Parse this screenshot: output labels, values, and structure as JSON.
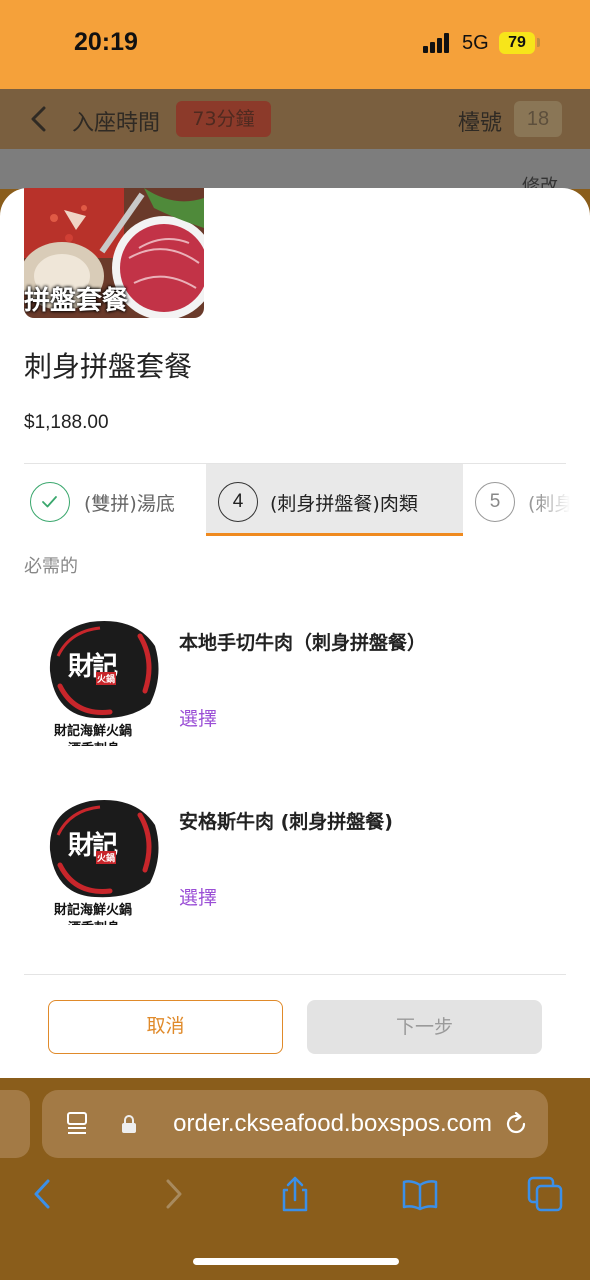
{
  "status": {
    "time": "20:19",
    "network": "5G",
    "battery": "79"
  },
  "header": {
    "seat_time_label": "入座時間",
    "seat_time_value": "73分鐘",
    "table_label": "檯號",
    "table_number": "18",
    "edit": "修改"
  },
  "product": {
    "image_caption": "拼盤套餐",
    "name": "刺身拼盤套餐",
    "price": "$1,188.00"
  },
  "steps": [
    {
      "label": "(雙拼)湯底",
      "state": "done"
    },
    {
      "number": "4",
      "label": "(刺身拼盤餐)肉類",
      "state": "active"
    },
    {
      "number": "5",
      "label": "(刺身",
      "state": "pending"
    }
  ],
  "section": {
    "required_label": "必需的"
  },
  "items": [
    {
      "name": "本地手切牛肉（刺身拼盤餐）",
      "action": "選擇",
      "logo_text": "財記",
      "logo_sub": "火鍋",
      "logo_caption": "財記海鮮火鍋",
      "logo_caption2": "酒香刺身"
    },
    {
      "name": "安格斯牛肉 (刺身拼盤餐)",
      "action": "選擇",
      "logo_text": "財記",
      "logo_sub": "火鍋",
      "logo_caption": "財記海鮮火鍋",
      "logo_caption2": "酒香刺身"
    }
  ],
  "footer": {
    "cancel": "取消",
    "next": "下一步"
  },
  "browser": {
    "url": "order.ckseafood.boxspos.com"
  },
  "colors": {
    "accent": "#ef8a1f",
    "select": "#9b4fd6",
    "status_bar": "#f5a13a",
    "done": "#3aa76d"
  },
  "icons": [
    "back-icon",
    "check-icon",
    "reader-icon",
    "lock-icon",
    "reload-icon",
    "back-arrow-icon",
    "forward-arrow-icon",
    "share-icon",
    "bookmarks-icon",
    "tabs-icon"
  ]
}
